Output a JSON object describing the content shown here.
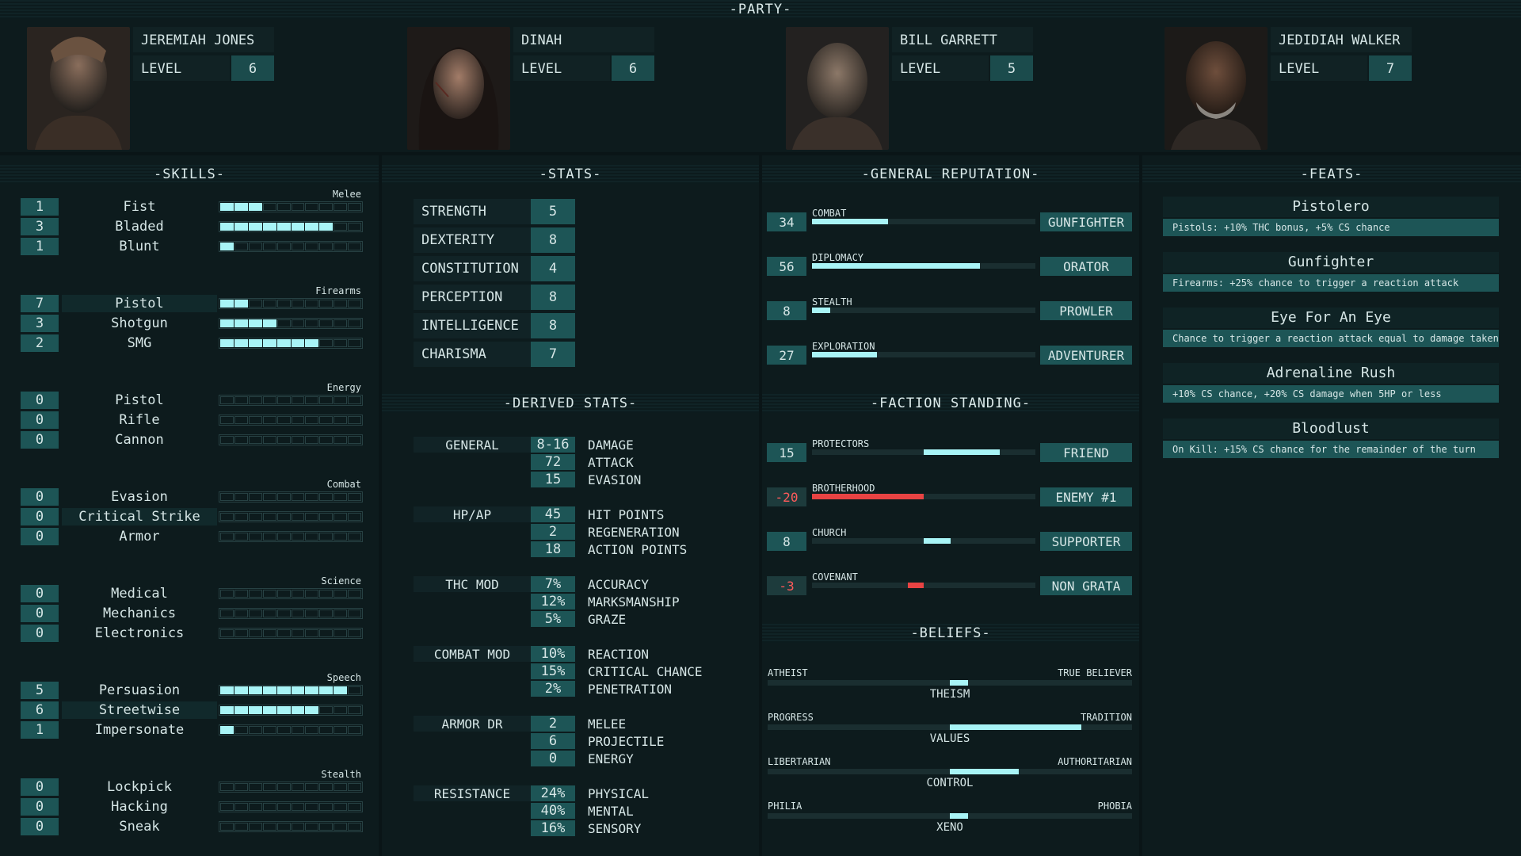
{
  "party": {
    "title": "-PARTY-",
    "members": [
      {
        "name": "JEREMIAH JONES",
        "level_label": "LEVEL",
        "level": "6"
      },
      {
        "name": "DINAH",
        "level_label": "LEVEL",
        "level": "6"
      },
      {
        "name": "BILL GARRETT",
        "level_label": "LEVEL",
        "level": "5"
      },
      {
        "name": "JEDIDIAH WALKER",
        "level_label": "LEVEL",
        "level": "7"
      }
    ]
  },
  "skills": {
    "title": "-SKILLS-",
    "max_segments": 10,
    "groups": [
      {
        "category": "Melee",
        "items": [
          {
            "value": "1",
            "name": "Fist",
            "fill": 3,
            "highlight": false
          },
          {
            "value": "3",
            "name": "Bladed",
            "fill": 8,
            "highlight": false
          },
          {
            "value": "1",
            "name": "Blunt",
            "fill": 1,
            "highlight": false
          }
        ]
      },
      {
        "category": "Firearms",
        "items": [
          {
            "value": "7",
            "name": "Pistol",
            "fill": 2,
            "highlight": true
          },
          {
            "value": "3",
            "name": "Shotgun",
            "fill": 4,
            "highlight": false
          },
          {
            "value": "2",
            "name": "SMG",
            "fill": 7,
            "highlight": false
          }
        ]
      },
      {
        "category": "Energy",
        "items": [
          {
            "value": "0",
            "name": "Pistol",
            "fill": 0,
            "highlight": false
          },
          {
            "value": "0",
            "name": "Rifle",
            "fill": 0,
            "highlight": false
          },
          {
            "value": "0",
            "name": "Cannon",
            "fill": 0,
            "highlight": false
          }
        ]
      },
      {
        "category": "Combat",
        "items": [
          {
            "value": "0",
            "name": "Evasion",
            "fill": 0,
            "highlight": false
          },
          {
            "value": "0",
            "name": "Critical Strike",
            "fill": 0,
            "highlight": true
          },
          {
            "value": "0",
            "name": "Armor",
            "fill": 0,
            "highlight": false
          }
        ]
      },
      {
        "category": "Science",
        "items": [
          {
            "value": "0",
            "name": "Medical",
            "fill": 0,
            "highlight": false
          },
          {
            "value": "0",
            "name": "Mechanics",
            "fill": 0,
            "highlight": false
          },
          {
            "value": "0",
            "name": "Electronics",
            "fill": 0,
            "highlight": false
          }
        ]
      },
      {
        "category": "Speech",
        "items": [
          {
            "value": "5",
            "name": "Persuasion",
            "fill": 9,
            "highlight": false
          },
          {
            "value": "6",
            "name": "Streetwise",
            "fill": 7,
            "highlight": true
          },
          {
            "value": "1",
            "name": "Impersonate",
            "fill": 1,
            "highlight": false
          }
        ]
      },
      {
        "category": "Stealth",
        "items": [
          {
            "value": "0",
            "name": "Lockpick",
            "fill": 0,
            "highlight": false
          },
          {
            "value": "0",
            "name": "Hacking",
            "fill": 0,
            "highlight": false
          },
          {
            "value": "0",
            "name": "Sneak",
            "fill": 0,
            "highlight": false
          }
        ]
      }
    ]
  },
  "stats": {
    "title": "-STATS-",
    "items": [
      {
        "label": "STRENGTH",
        "value": "5"
      },
      {
        "label": "DEXTERITY",
        "value": "8"
      },
      {
        "label": "CONSTITUTION",
        "value": "4"
      },
      {
        "label": "PERCEPTION",
        "value": "8"
      },
      {
        "label": "INTELLIGENCE",
        "value": "8"
      },
      {
        "label": "CHARISMA",
        "value": "7"
      }
    ]
  },
  "derived": {
    "title": "-DERIVED STATS-",
    "groups": [
      {
        "group": "GENERAL",
        "rows": [
          {
            "value": "8-16",
            "label": "DAMAGE"
          },
          {
            "value": "72",
            "label": "ATTACK"
          },
          {
            "value": "15",
            "label": "EVASION"
          }
        ]
      },
      {
        "group": "HP/AP",
        "rows": [
          {
            "value": "45",
            "label": "HIT POINTS"
          },
          {
            "value": "2",
            "label": "REGENERATION"
          },
          {
            "value": "18",
            "label": "ACTION POINTS"
          }
        ]
      },
      {
        "group": "THC MOD",
        "rows": [
          {
            "value": "7%",
            "label": "ACCURACY"
          },
          {
            "value": "12%",
            "label": "MARKSMANSHIP"
          },
          {
            "value": "5%",
            "label": "GRAZE"
          }
        ]
      },
      {
        "group": "COMBAT MOD",
        "rows": [
          {
            "value": "10%",
            "label": "REACTION"
          },
          {
            "value": "15%",
            "label": "CRITICAL CHANCE"
          },
          {
            "value": "2%",
            "label": "PENETRATION"
          }
        ]
      },
      {
        "group": "ARMOR DR",
        "rows": [
          {
            "value": "2",
            "label": "MELEE"
          },
          {
            "value": "6",
            "label": "PROJECTILE"
          },
          {
            "value": "0",
            "label": "ENERGY"
          }
        ]
      },
      {
        "group": "RESISTANCE",
        "rows": [
          {
            "value": "24%",
            "label": "PHYSICAL"
          },
          {
            "value": "40%",
            "label": "MENTAL"
          },
          {
            "value": "16%",
            "label": "SENSORY"
          }
        ]
      }
    ]
  },
  "reputation": {
    "title": "-GENERAL REPUTATION-",
    "items": [
      {
        "value": "34",
        "category": "COMBAT",
        "title": "GUNFIGHTER",
        "fraction": 0.34,
        "negative": false
      },
      {
        "value": "56",
        "category": "DIPLOMACY",
        "title": "ORATOR",
        "fraction": 0.75,
        "negative": false
      },
      {
        "value": "8",
        "category": "STEALTH",
        "title": "PROWLER",
        "fraction": 0.08,
        "negative": false
      },
      {
        "value": "27",
        "category": "EXPLORATION",
        "title": "ADVENTURER",
        "fraction": 0.29,
        "negative": false
      }
    ]
  },
  "faction": {
    "title": "-FACTION STANDING-",
    "items": [
      {
        "value": "15",
        "category": "PROTECTORS",
        "title": "FRIEND",
        "start": 0.5,
        "end": 0.84,
        "negative": false
      },
      {
        "value": "-20",
        "category": "BROTHERHOOD",
        "title": "ENEMY #1",
        "start": 0.0,
        "end": 0.5,
        "negative": true
      },
      {
        "value": "8",
        "category": "CHURCH",
        "title": "SUPPORTER",
        "start": 0.5,
        "end": 0.62,
        "negative": false
      },
      {
        "value": "-3",
        "category": "COVENANT",
        "title": "NON GRATA",
        "start": 0.43,
        "end": 0.5,
        "negative": true
      }
    ]
  },
  "beliefs": {
    "title": "-BELIEFS-",
    "items": [
      {
        "left": "ATHEIST",
        "right": "TRUE BELIEVER",
        "name": "THEISM",
        "start": 0.5,
        "end": 0.55
      },
      {
        "left": "PROGRESS",
        "right": "TRADITION",
        "name": "VALUES",
        "start": 0.5,
        "end": 0.86
      },
      {
        "left": "LIBERTARIAN",
        "right": "AUTHORITARIAN",
        "name": "CONTROL",
        "start": 0.5,
        "end": 0.69
      },
      {
        "left": "PHILIA",
        "right": "PHOBIA",
        "name": "XENO",
        "start": 0.5,
        "end": 0.55
      }
    ]
  },
  "feats": {
    "title": "-FEATS-",
    "items": [
      {
        "name": "Pistolero",
        "desc": "Pistols: +10% THC bonus, +5% CS chance"
      },
      {
        "name": "Gunfighter",
        "desc": "Firearms: +25% chance to trigger a reaction attack"
      },
      {
        "name": "Eye For An Eye",
        "desc": "Chance to trigger a reaction attack equal to damage taken"
      },
      {
        "name": "Adrenaline Rush",
        "desc": "+10% CS chance, +20% CS damage when 5HP or less"
      },
      {
        "name": "Bloodlust",
        "desc": "On Kill: +15% CS chance for the remainder of the turn"
      }
    ]
  },
  "colors": {
    "accent": "#a8f4f6",
    "value_bg": "#1d5556",
    "negative": "#e84343",
    "background": "#0a1517"
  }
}
